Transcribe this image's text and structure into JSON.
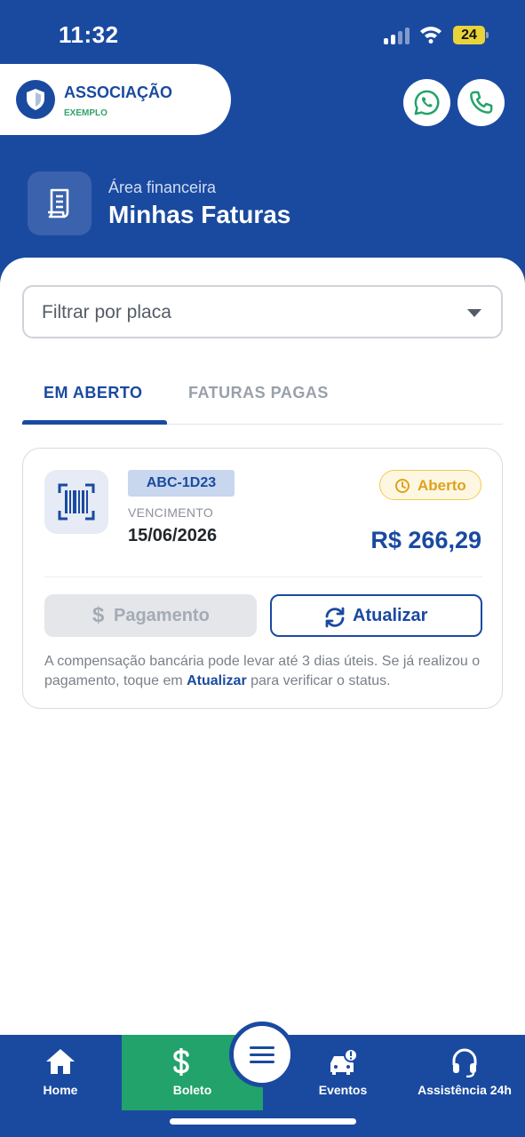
{
  "status_bar": {
    "time": "11:32",
    "battery": "24",
    "icons": [
      "signal-icon",
      "wifi-icon",
      "battery-icon"
    ]
  },
  "brand": {
    "name": "ASSOCIAÇÃO",
    "subtitle": "EXEMPLO",
    "logo_icon": "shield-icon"
  },
  "contact_buttons": [
    {
      "icon": "whatsapp-icon"
    },
    {
      "icon": "phone-icon"
    }
  ],
  "section": {
    "kicker": "Área financeira",
    "title": "Minhas Faturas",
    "icon": "receipt-icon"
  },
  "filter": {
    "placeholder": "Filtrar por placa"
  },
  "tabs": [
    {
      "label": "EM ABERTO",
      "active": true
    },
    {
      "label": "FATURAS PAGAS",
      "active": false
    }
  ],
  "invoice": {
    "plate": "ABC-1D23",
    "due_label": "VENCIMENTO",
    "due_date": "15/06/2026",
    "status": "Aberto",
    "amount": "R$ 266,29",
    "pay_symbol": "$",
    "pay_label": "Pagamento",
    "refresh_label": "Atualizar",
    "note_part1": "A compensação bancária pode levar até 3 dias úteis. Se já realizou o pagamento, toque em ",
    "note_link": "Atualizar",
    "note_part2": " para verificar o status."
  },
  "bottom_nav": {
    "home": "Home",
    "boleto": "Boleto",
    "eventos": "Eventos",
    "assistencia": "Assistência 24h",
    "center_icon": "menu-icon"
  },
  "colors": {
    "primary": "#1a4aa0",
    "accent_green": "#21a36b",
    "status_yellow": "#e0a21b"
  }
}
